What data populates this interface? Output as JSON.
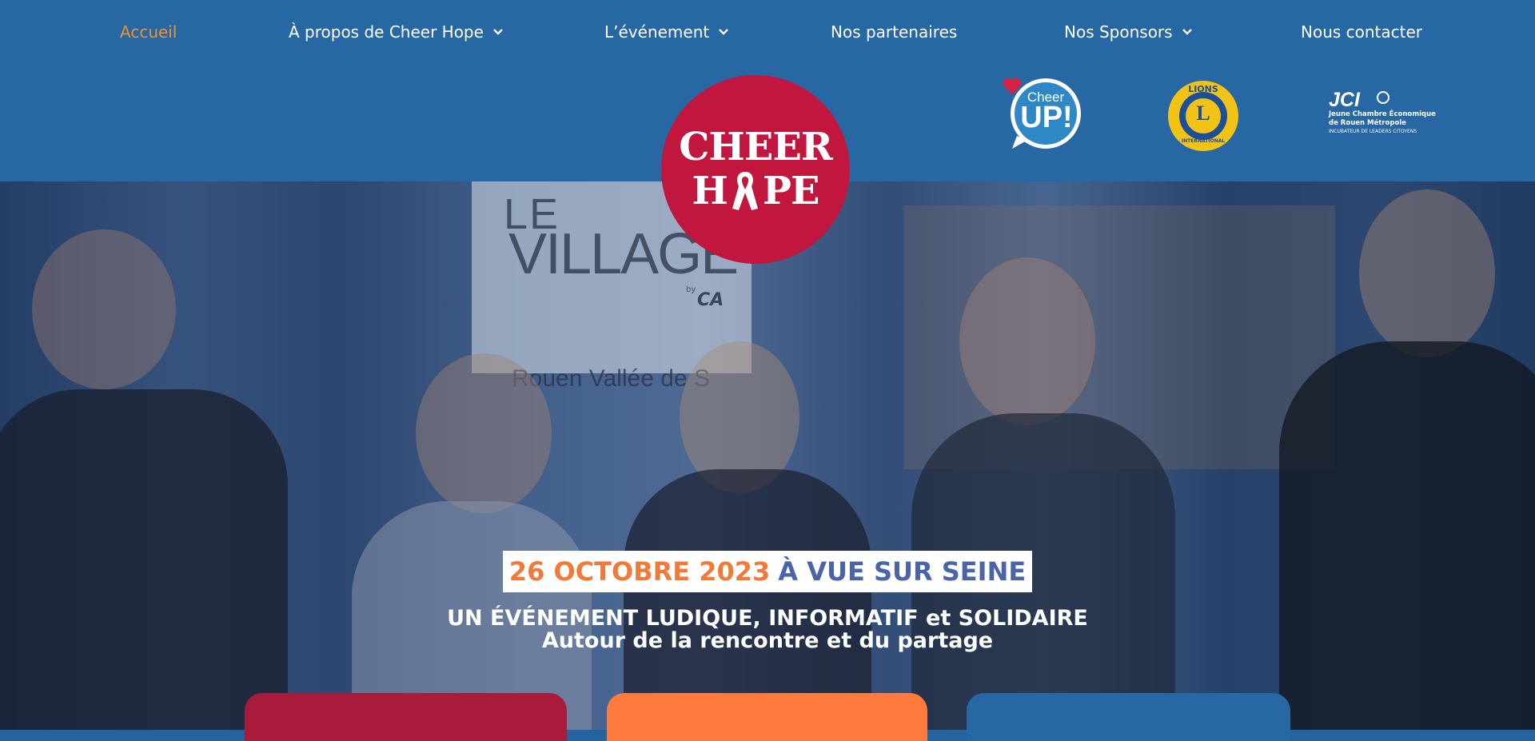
{
  "nav": {
    "items": [
      {
        "label": "Accueil",
        "active": true,
        "dropdown": false
      },
      {
        "label": "À propos de Cheer Hope",
        "dropdown": true
      },
      {
        "label": "L’événement",
        "dropdown": true
      },
      {
        "label": "Nos partenaires",
        "dropdown": false
      },
      {
        "label": "Nos Sponsors",
        "dropdown": true
      },
      {
        "label": "Nous contacter",
        "dropdown": false
      }
    ],
    "active_color": "#f0922f"
  },
  "logo": {
    "line1": "CHEER",
    "line2_left": "H",
    "line2_right": "PE",
    "color": "#c1173f"
  },
  "partners": {
    "cheerup": {
      "small": "Cheer",
      "big": "UP!"
    },
    "lions": {
      "top": "LIONS",
      "letter": "L",
      "bottom": "INTERNATIONAL"
    },
    "jci": {
      "mark": "JCI",
      "line1": "Jeune Chambre Économique",
      "line2": "de Rouen Métropole",
      "line3": "INCUBATEUR DE LEADERS CITOYENS"
    }
  },
  "hero": {
    "date_part": "26 OCTOBRE 2023",
    "place_part": "À VUE SUR SEINE",
    "tagline1": "UN ÉVÉNEMENT LUDIQUE, INFORMATIF et SOLIDAIRE",
    "tagline2": "Autour de la rencontre et du partage"
  },
  "photo_signage": {
    "le": "LE",
    "village": "VILLAGE",
    "by": "by",
    "ca": "CA",
    "location": "Rouen Vallée de S"
  },
  "colors": {
    "header": "#2667a4",
    "card1": "#a91b3a",
    "card2": "#ff7a3d",
    "card3": "#2667a4",
    "date_orange": "#f07a3a",
    "place_blue": "#4b64a8"
  }
}
